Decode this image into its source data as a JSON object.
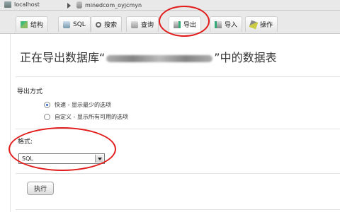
{
  "breadcrumb": {
    "server_label": "localhost",
    "database_label": "minedcom_oyjcmyn"
  },
  "tabs": [
    {
      "label": "结构",
      "icon": "structure-icon"
    },
    {
      "label": "SQL",
      "icon": "sql-icon"
    },
    {
      "label": "搜索",
      "icon": "search-icon"
    },
    {
      "label": "查询",
      "icon": "query-icon"
    },
    {
      "label": "导出",
      "icon": "export-icon",
      "active": true
    },
    {
      "label": "导入",
      "icon": "import-icon"
    },
    {
      "label": "操作",
      "icon": "operations-icon"
    }
  ],
  "heading": {
    "prefix": "正在导出数据库“",
    "suffix": "”中的数据表"
  },
  "export_method": {
    "title": "导出方式",
    "options": [
      {
        "label": "快速 - 显示最少的选项",
        "checked": true
      },
      {
        "label": "自定义 - 显示所有可用的选项",
        "checked": false
      }
    ]
  },
  "format": {
    "label": "格式:",
    "selected": "SQL"
  },
  "go_button": "执行",
  "annotation_color": "#e21b1b"
}
